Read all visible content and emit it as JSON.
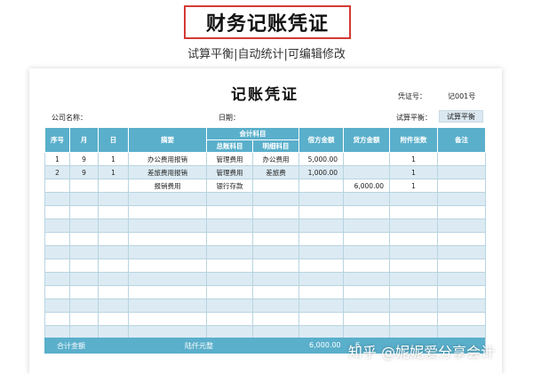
{
  "banner_title": "财务记账凭证",
  "subtitle": "试算平衡|自动统计|可编辑修改",
  "voucher": {
    "title": "记账凭证",
    "voucher_no_label": "凭证号：",
    "voucher_no_value": "记001号",
    "company_label": "公司名称：",
    "date_label": "日期：",
    "balance_label": "试算平衡：",
    "balance_button": "试算平衡"
  },
  "table": {
    "headers": {
      "seq": "序号",
      "month": "月",
      "day": "日",
      "summary": "摘要",
      "account_group": "会计科目",
      "general_account": "总账科目",
      "detail_account": "明细科目",
      "debit": "借方金额",
      "credit": "贷方金额",
      "attachments": "附件张数",
      "remarks": "备注"
    },
    "rows": [
      [
        "1",
        "9",
        "1",
        "办公费用报销",
        "管理费用",
        "办公费用",
        "5,000.00",
        "",
        "1",
        ""
      ],
      [
        "2",
        "9",
        "1",
        "差旅费用报销",
        "管理费用",
        "差旅费",
        "1,000.00",
        "",
        "1",
        ""
      ],
      [
        "",
        "",
        "",
        "报销费用",
        "银行存款",
        "",
        "",
        "6,000.00",
        "1",
        ""
      ],
      [
        "",
        "",
        "",
        "",
        "",
        "",
        "",
        "",
        "",
        ""
      ],
      [
        "",
        "",
        "",
        "",
        "",
        "",
        "",
        "",
        "",
        ""
      ],
      [
        "",
        "",
        "",
        "",
        "",
        "",
        "",
        "",
        "",
        ""
      ],
      [
        "",
        "",
        "",
        "",
        "",
        "",
        "",
        "",
        "",
        ""
      ],
      [
        "",
        "",
        "",
        "",
        "",
        "",
        "",
        "",
        "",
        ""
      ],
      [
        "",
        "",
        "",
        "",
        "",
        "",
        "",
        "",
        "",
        ""
      ],
      [
        "",
        "",
        "",
        "",
        "",
        "",
        "",
        "",
        "",
        ""
      ],
      [
        "",
        "",
        "",
        "",
        "",
        "",
        "",
        "",
        "",
        ""
      ],
      [
        "",
        "",
        "",
        "",
        "",
        "",
        "",
        "",
        "",
        ""
      ],
      [
        "",
        "",
        "",
        "",
        "",
        "",
        "",
        "",
        "",
        ""
      ],
      [
        "",
        "",
        "",
        "",
        "",
        "",
        "",
        "",
        "",
        ""
      ],
      [
        "",
        "",
        "",
        "",
        "",
        "",
        "",
        "",
        "",
        ""
      ]
    ]
  },
  "footer": {
    "total_label": "合计金额",
    "amount_in_words": "陆仟元整",
    "total_debit": "6,000.00",
    "total_credit_partial": "6"
  },
  "watermark": "知乎 @妮妮爱分享会计"
}
